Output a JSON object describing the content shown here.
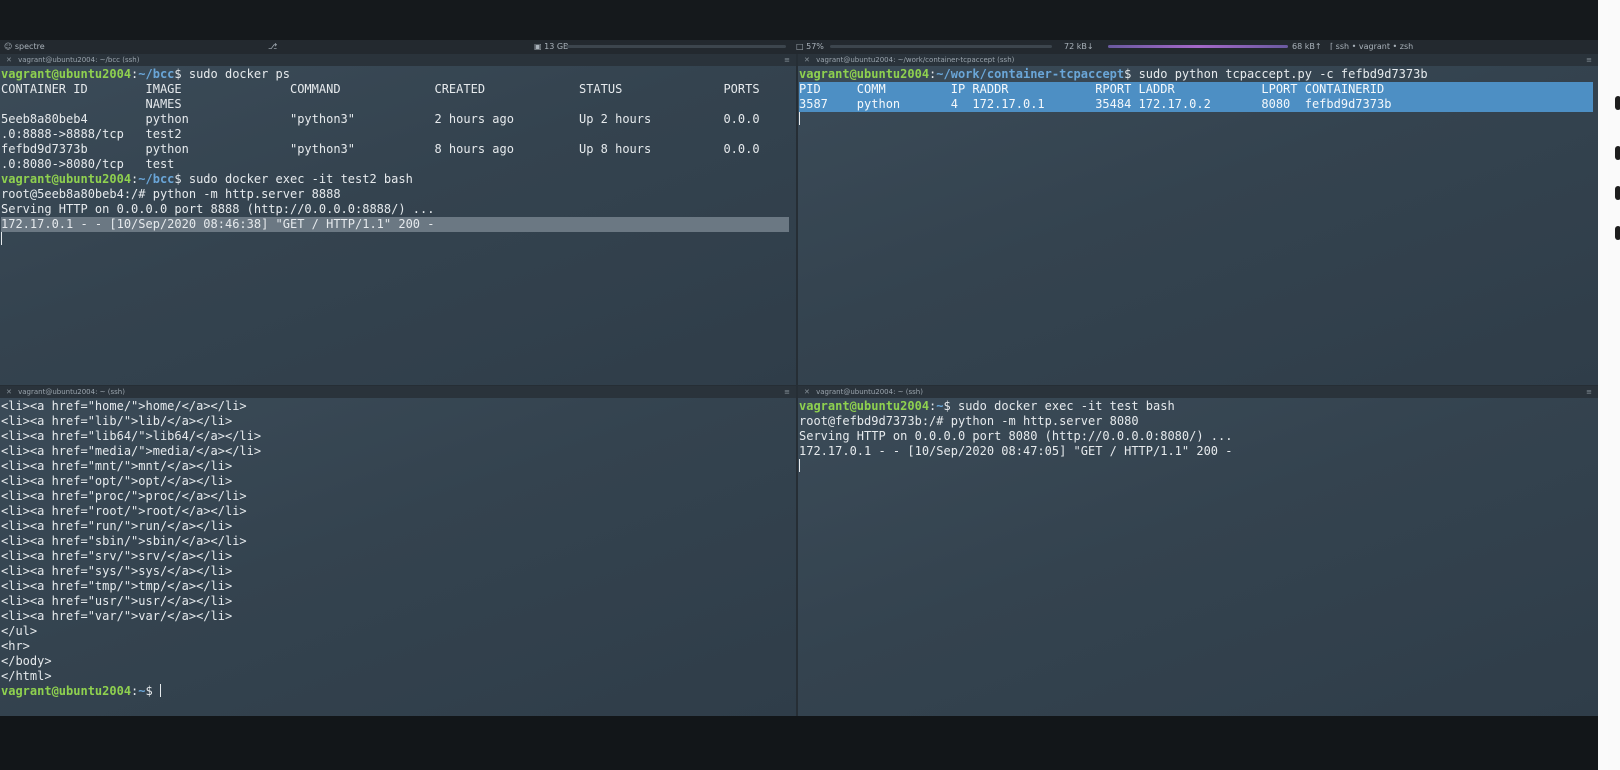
{
  "status_bar": {
    "session": "spectre",
    "cwd_marker": "⎇",
    "memory": "13 GB",
    "cpu": "57%",
    "net_down": "72 kB↓",
    "net_up": "68 kB↑",
    "session_info": "ssh • vagrant • zsh"
  },
  "panes": {
    "top_left": {
      "title": "vagrant@ubuntu2004: ~/bcc (ssh)",
      "prompt_user": "vagrant@ubuntu2004",
      "prompt_path": "~/bcc",
      "cmd_ps": "sudo docker ps",
      "ps_header": "CONTAINER ID        IMAGE               COMMAND             CREATED             STATUS              PORTS",
      "ps_header_names": "                    NAMES",
      "row1_a": "5eeb8a80beb4        python              \"python3\"           2 hours ago         Up 2 hours          0.0.0",
      "row1_b": ".0:8888->8888/tcp   test2",
      "row2_a": "fefbd9d7373b        python              \"python3\"           8 hours ago         Up 8 hours          0.0.0",
      "row2_b": ".0:8080->8080/tcp   test",
      "cmd_exec": "sudo docker exec -it test2 bash",
      "root_prompt": "root@5eeb8a80beb4:/# python -m http.server 8888",
      "serving": "Serving HTTP on 0.0.0.0 port 8888 (http://0.0.0.0:8888/) ...",
      "request": "172.17.0.1 - - [10/Sep/2020 08:46:38] \"GET / HTTP/1.1\" 200 -"
    },
    "top_right": {
      "title": "vagrant@ubuntu2004: ~/work/container-tcpaccept (ssh)",
      "prompt_user": "vagrant@ubuntu2004",
      "prompt_path": "~/work/container-tcpaccept",
      "cmd": "sudo python tcpaccept.py -c fefbd9d7373b",
      "table_header": "PID     COMM         IP RADDR            RPORT LADDR            LPORT CONTAINERID",
      "table_row": "3587    python       4  172.17.0.1       35484 172.17.0.2       8080  fefbd9d7373b"
    },
    "bottom_left": {
      "title": "vagrant@ubuntu2004: ~ (ssh)",
      "lines": [
        "<li><a href=\"home/\">home/</a></li>",
        "<li><a href=\"lib/\">lib/</a></li>",
        "<li><a href=\"lib64/\">lib64/</a></li>",
        "<li><a href=\"media/\">media/</a></li>",
        "<li><a href=\"mnt/\">mnt/</a></li>",
        "<li><a href=\"opt/\">opt/</a></li>",
        "<li><a href=\"proc/\">proc/</a></li>",
        "<li><a href=\"root/\">root/</a></li>",
        "<li><a href=\"run/\">run/</a></li>",
        "<li><a href=\"sbin/\">sbin/</a></li>",
        "<li><a href=\"srv/\">srv/</a></li>",
        "<li><a href=\"sys/\">sys/</a></li>",
        "<li><a href=\"tmp/\">tmp/</a></li>",
        "<li><a href=\"usr/\">usr/</a></li>",
        "<li><a href=\"var/\">var/</a></li>",
        "</ul>",
        "<hr>",
        "</body>",
        "</html>"
      ],
      "prompt_user": "vagrant@ubuntu2004",
      "prompt_path": "~"
    },
    "bottom_right": {
      "title": "vagrant@ubuntu2004: ~ (ssh)",
      "prompt_user": "vagrant@ubuntu2004",
      "prompt_path": "~",
      "cmd": "sudo docker exec -it test bash",
      "root_prompt": "root@fefbd9d7373b:/# python -m http.server 8080",
      "serving": "Serving HTTP on 0.0.0.0 port 8080 (http://0.0.0.0:8080/) ...",
      "request": "172.17.0.1 - - [10/Sep/2020 08:47:05] \"GET / HTTP/1.1\" 200 -"
    }
  },
  "colors": {
    "prompt_user": "#8fd14f",
    "prompt_path": "#6aa6d8",
    "selection": "#4d8fc4"
  }
}
